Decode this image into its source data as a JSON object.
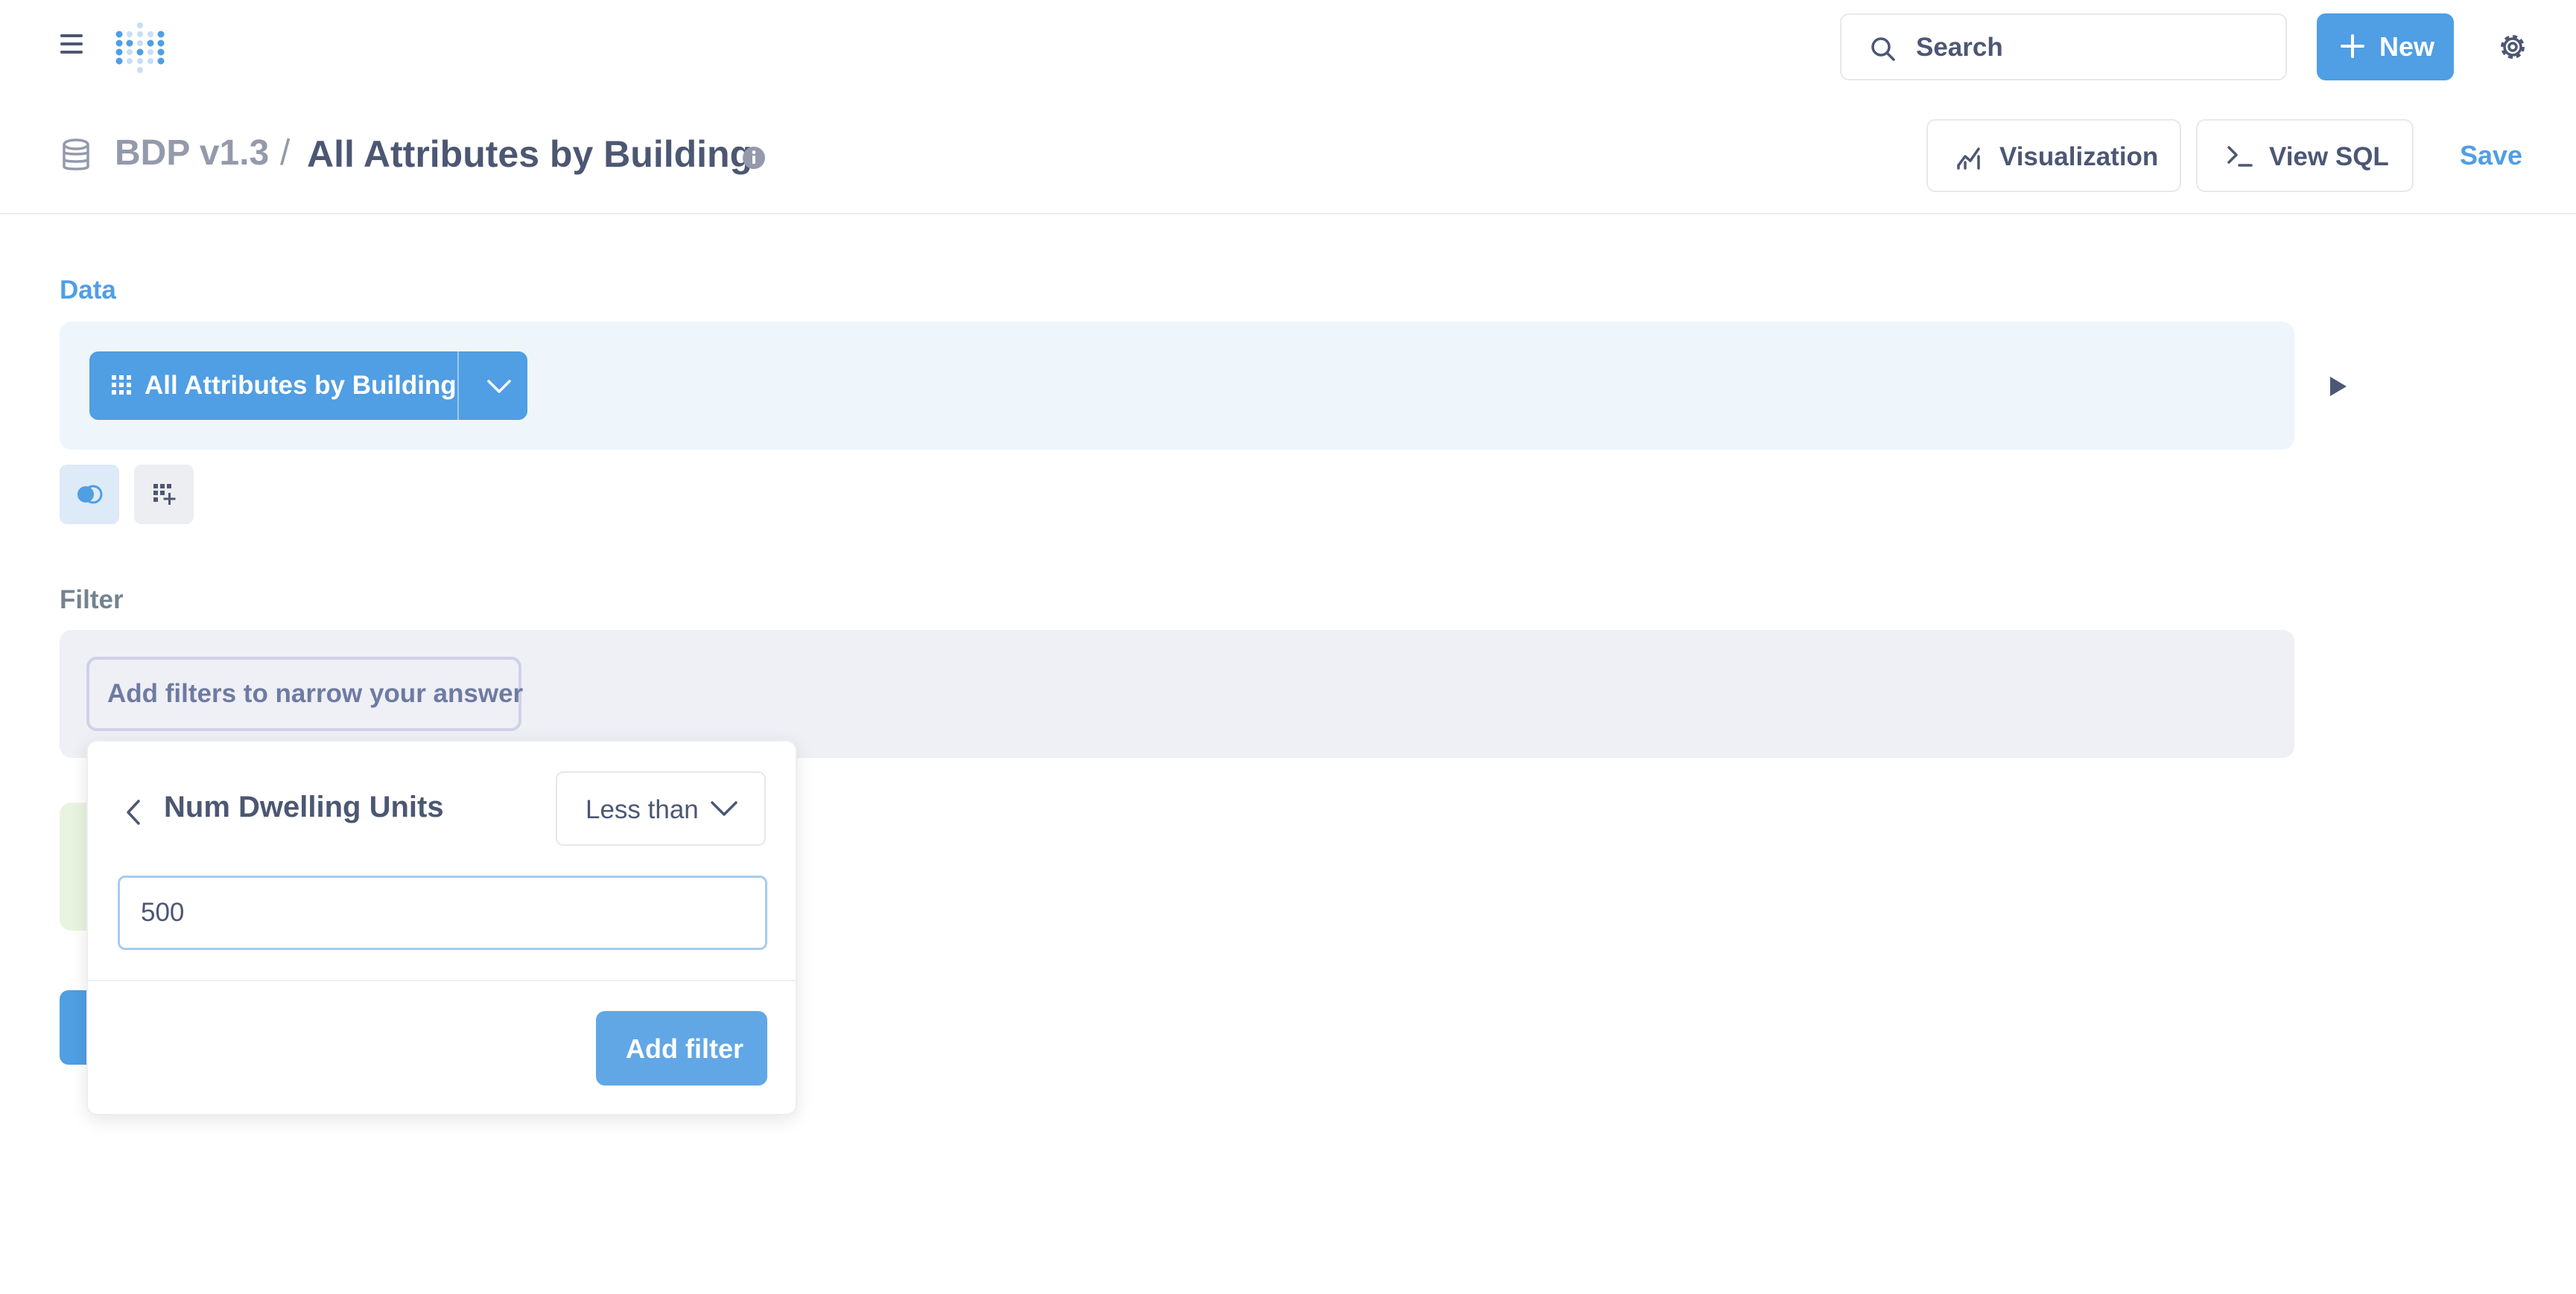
{
  "topbar": {
    "search_label": "Search",
    "new_label": "New"
  },
  "header": {
    "database": "BDP v1.3",
    "separator": "/",
    "title": "All Attributes by Building",
    "visualization_label": "Visualization",
    "view_sql_label": "View SQL",
    "save_label": "Save"
  },
  "data_section": {
    "label": "Data",
    "source": "All Attributes by Building"
  },
  "filter_section": {
    "label": "Filter",
    "placeholder_pill": "Add filters to narrow your answer"
  },
  "filter_popover": {
    "column": "Num Dwelling Units",
    "operator": "Less than",
    "value": "500",
    "add_button": "Add filter"
  },
  "colors": {
    "brand": "#509ee3",
    "text": "#4c5773",
    "muted": "#949aab"
  }
}
